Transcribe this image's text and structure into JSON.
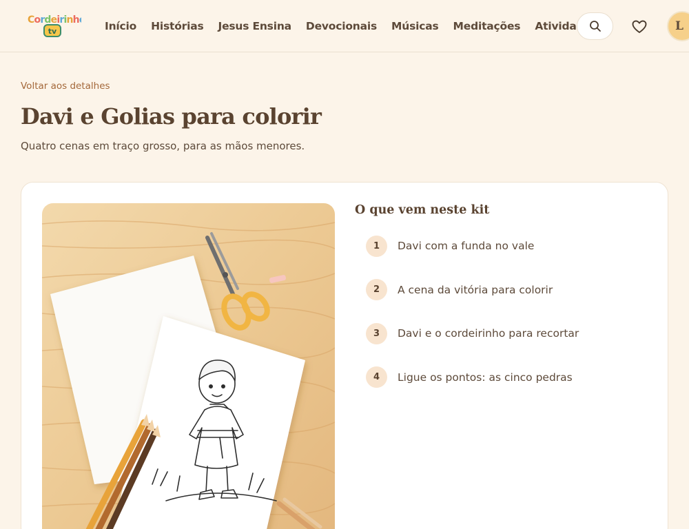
{
  "header": {
    "logo_text_top": "Cordeirinho",
    "logo_text_bottom": "tv",
    "nav": [
      {
        "label": "Início"
      },
      {
        "label": "Histórias"
      },
      {
        "label": "Jesus Ensina"
      },
      {
        "label": "Devocionais"
      },
      {
        "label": "Músicas"
      },
      {
        "label": "Meditações"
      },
      {
        "label": "Atividades"
      }
    ],
    "search_icon": "search-icon",
    "favorite_icon": "heart-icon",
    "avatar_initial": "L"
  },
  "page": {
    "back_link": "Voltar aos detalhes",
    "title": "Davi e Golias para colorir",
    "subtitle": "Quatro cenas em traço grosso, para as mãos menores."
  },
  "kit": {
    "title": "O que vem neste kit",
    "items": [
      {
        "number": "1",
        "label": "Davi com a funda no vale"
      },
      {
        "number": "2",
        "label": "A cena da vitória para colorir"
      },
      {
        "number": "3",
        "label": "Davi e o cordeirinho para recortar"
      },
      {
        "number": "4",
        "label": "Ligue os pontos: as cinco pedras"
      }
    ]
  },
  "colors": {
    "background": "#fcf4e9",
    "accent": "#a4683a",
    "heading": "#5a4330",
    "number_badge": "#f8e4cf"
  }
}
